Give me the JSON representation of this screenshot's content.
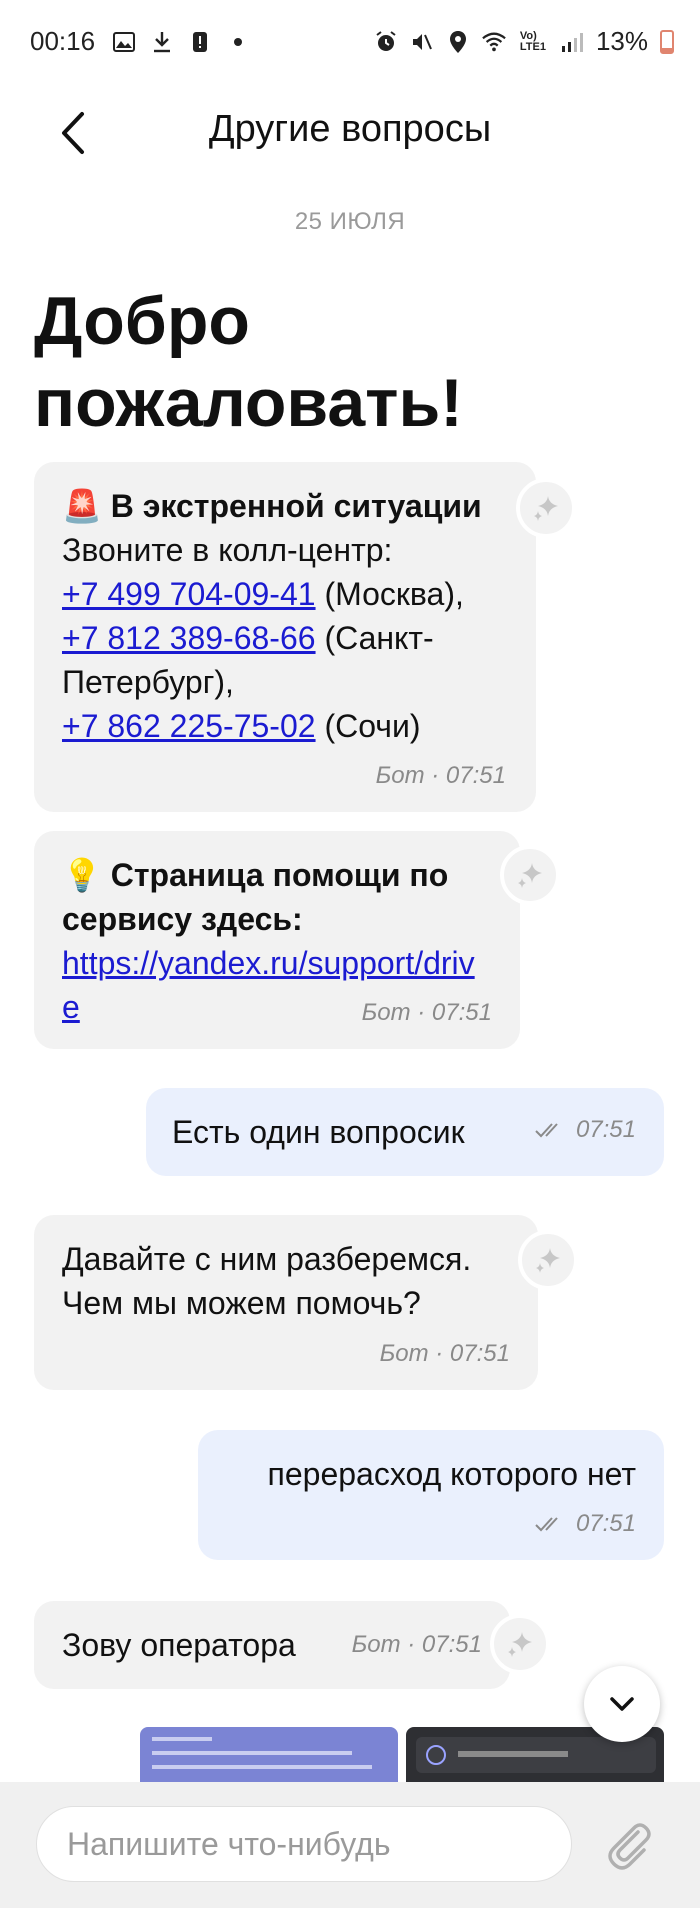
{
  "status_bar": {
    "time": "00:16",
    "battery": "13%",
    "left_icons": [
      "image-icon",
      "download-icon",
      "alert-icon",
      "dot-icon"
    ],
    "right_icons": [
      "alarm-icon",
      "mute-icon",
      "location-icon",
      "wifi-icon",
      "volte-icon",
      "signal-icon",
      "battery-icon"
    ]
  },
  "header": {
    "title": "Другие вопросы"
  },
  "date_label": "25 ИЮЛЯ",
  "welcome": "Добро пожаловать!",
  "messages": [
    {
      "emoji": "🚨",
      "title": "В экстренной ситуации",
      "line1": "Звоните в колл-центр:",
      "phone1": "+7 499 704-09-41",
      "city1": " (Москва),",
      "phone2": "+7 812 389-68-66",
      "city2": " (Санкт-Петербург),",
      "phone3": "+7 862 225-75-02",
      "city3": " (Сочи)",
      "meta": "Бот · 07:51"
    },
    {
      "emoji": "💡",
      "title": "Страница помощи по сервису здесь:",
      "link": "https://yandex.ru/support/drive",
      "meta": "Бот · 07:51"
    },
    {
      "text": "Есть один вопросик",
      "time": "07:51"
    },
    {
      "text": "Давайте с ним разберемся. Чем мы можем помочь?",
      "meta": "Бот · 07:51"
    },
    {
      "text": "перерасход которого нет",
      "time": "07:51"
    },
    {
      "text": "Зову оператора",
      "meta": "Бот · 07:51"
    }
  ],
  "composer": {
    "placeholder": "Напишите что-нибудь"
  },
  "colors": {
    "link": "#1b1bd1",
    "bot_bubble": "#f2f2f2",
    "user_bubble": "#eaf0fd"
  }
}
